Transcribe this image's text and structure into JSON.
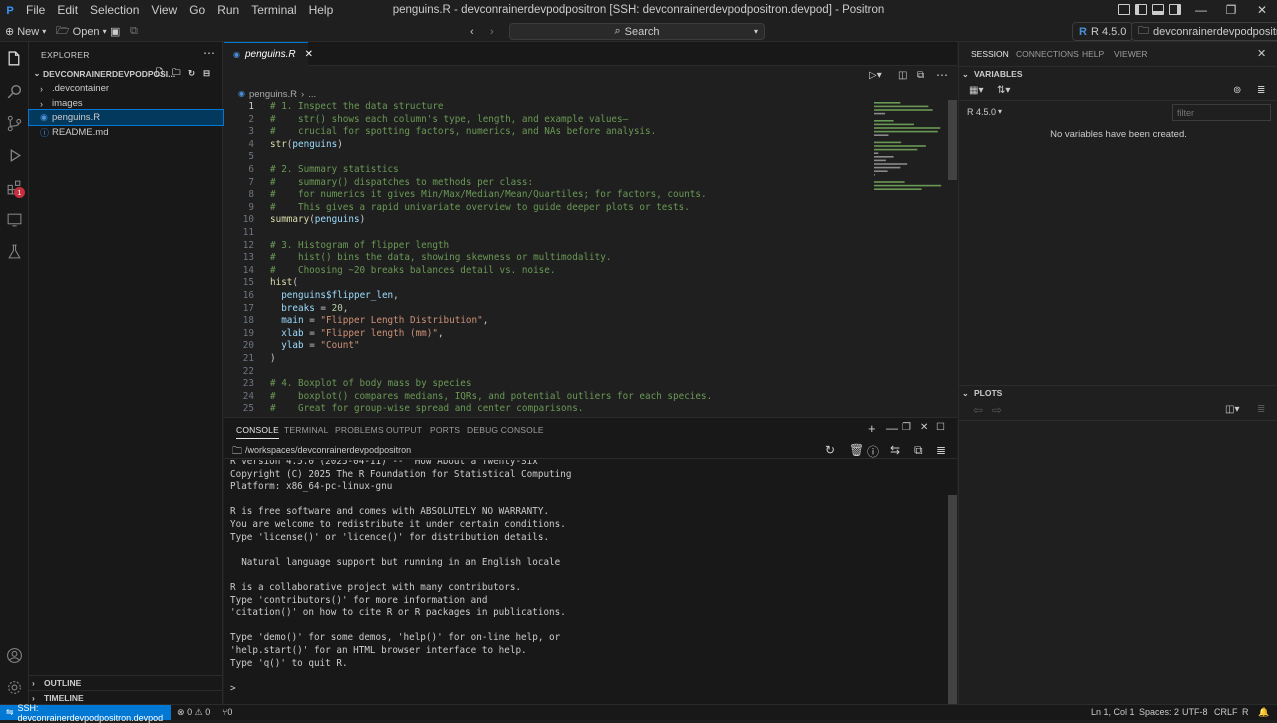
{
  "window": {
    "title": "penguins.R - devconrainerdevpodpositron [SSH: devconrainerdevpodpositron.devpod] - Positron",
    "menu": [
      "File",
      "Edit",
      "Selection",
      "View",
      "Go",
      "Run",
      "Terminal",
      "Help"
    ]
  },
  "toolbar": {
    "new_label": "New",
    "open_label": "Open",
    "search_label": "Search",
    "r_version": "R 4.5.0",
    "workspace": "devconrainerdevpodpositron"
  },
  "explorer": {
    "title": "EXPLORER",
    "root": "DEVCONRAINERDEVPODPOSI...",
    "items": [
      {
        "label": ".devcontainer"
      },
      {
        "label": "images"
      },
      {
        "label": "penguins.R"
      },
      {
        "label": "README.md"
      }
    ],
    "outline": "OUTLINE",
    "timeline": "TIMELINE"
  },
  "editor": {
    "tab_label": "penguins.R",
    "breadcrumb_file": "penguins.R",
    "breadcrumb_more": "...",
    "line_numbers": [
      "1",
      "2",
      "3",
      "4",
      "5",
      "6",
      "7",
      "8",
      "9",
      "10",
      "11",
      "12",
      "13",
      "14",
      "15",
      "16",
      "17",
      "18",
      "19",
      "20",
      "21",
      "22",
      "23",
      "24",
      "25"
    ],
    "lines": [
      "# 1. Inspect the data structure",
      "#    str() shows each column's type, length, and example values—",
      "#    crucial for spotting factors, numerics, and NAs before analysis.",
      "str(penguins)",
      "",
      "# 2. Summary statistics",
      "#    summary() dispatches to methods per class:",
      "#    for numerics it gives Min/Max/Median/Mean/Quartiles; for factors, counts.",
      "#    This gives a rapid univariate overview to guide deeper plots or tests.",
      "summary(penguins)",
      "",
      "# 3. Histogram of flipper length",
      "#    hist() bins the data, showing skewness or multimodality.",
      "#    Choosing ~20 breaks balances detail vs. noise.",
      "hist(",
      "  penguins$flipper_len,",
      "  breaks = 20,",
      "  main = \"Flipper Length Distribution\",",
      "  xlab = \"Flipper length (mm)\",",
      "  ylab = \"Count\"",
      ")",
      "",
      "# 4. Boxplot of body mass by species",
      "#    boxplot() compares medians, IQRs, and potential outliers for each species.",
      "#    Great for group-wise spread and center comparisons."
    ]
  },
  "panel": {
    "tabs": [
      "CONSOLE",
      "TERMINAL",
      "PROBLEMS",
      "OUTPUT",
      "PORTS",
      "DEBUG CONSOLE"
    ],
    "path": "/workspaces/devconrainerdevpodpositron",
    "console_lines": [
      "R version 4.5.0 (2025-04-11) -- \"How About a Twenty-Six\"",
      "Copyright (C) 2025 The R Foundation for Statistical Computing",
      "Platform: x86_64-pc-linux-gnu",
      "",
      "R is free software and comes with ABSOLUTELY NO WARRANTY.",
      "You are welcome to redistribute it under certain conditions.",
      "Type 'license()' or 'licence()' for distribution details.",
      "",
      "  Natural language support but running in an English locale",
      "",
      "R is a collaborative project with many contributors.",
      "Type 'contributors()' for more information and",
      "'citation()' on how to cite R or R packages in publications.",
      "",
      "Type 'demo()' for some demos, 'help()' for on-line help, or",
      "'help.start()' for an HTML browser interface to help.",
      "Type 'q()' to quit R.",
      "",
      ">"
    ]
  },
  "rightpane": {
    "tabs": [
      "SESSION",
      "CONNECTIONS",
      "HELP",
      "VIEWER"
    ],
    "variables_title": "VARIABLES",
    "r_version": "R 4.5.0",
    "filter_placeholder": "filter",
    "empty_message": "No variables have been created.",
    "plots_title": "PLOTS"
  },
  "statusbar": {
    "remote": "SSH: devconrainerdevpodpositron.devpod",
    "errors": "0",
    "warnings": "0",
    "ports": "0",
    "position": "Ln 1, Col 1",
    "spaces": "Spaces: 2",
    "encoding": "UTF-8",
    "eol": "CRLF",
    "language": "R"
  },
  "badges": {
    "extensions": "1"
  },
  "colors": {
    "accent": "#0078d4",
    "comment": "#6a9955",
    "string": "#ce9178",
    "function": "#dcdcaa",
    "number": "#b5cea8",
    "variable": "#9cdcfe"
  }
}
